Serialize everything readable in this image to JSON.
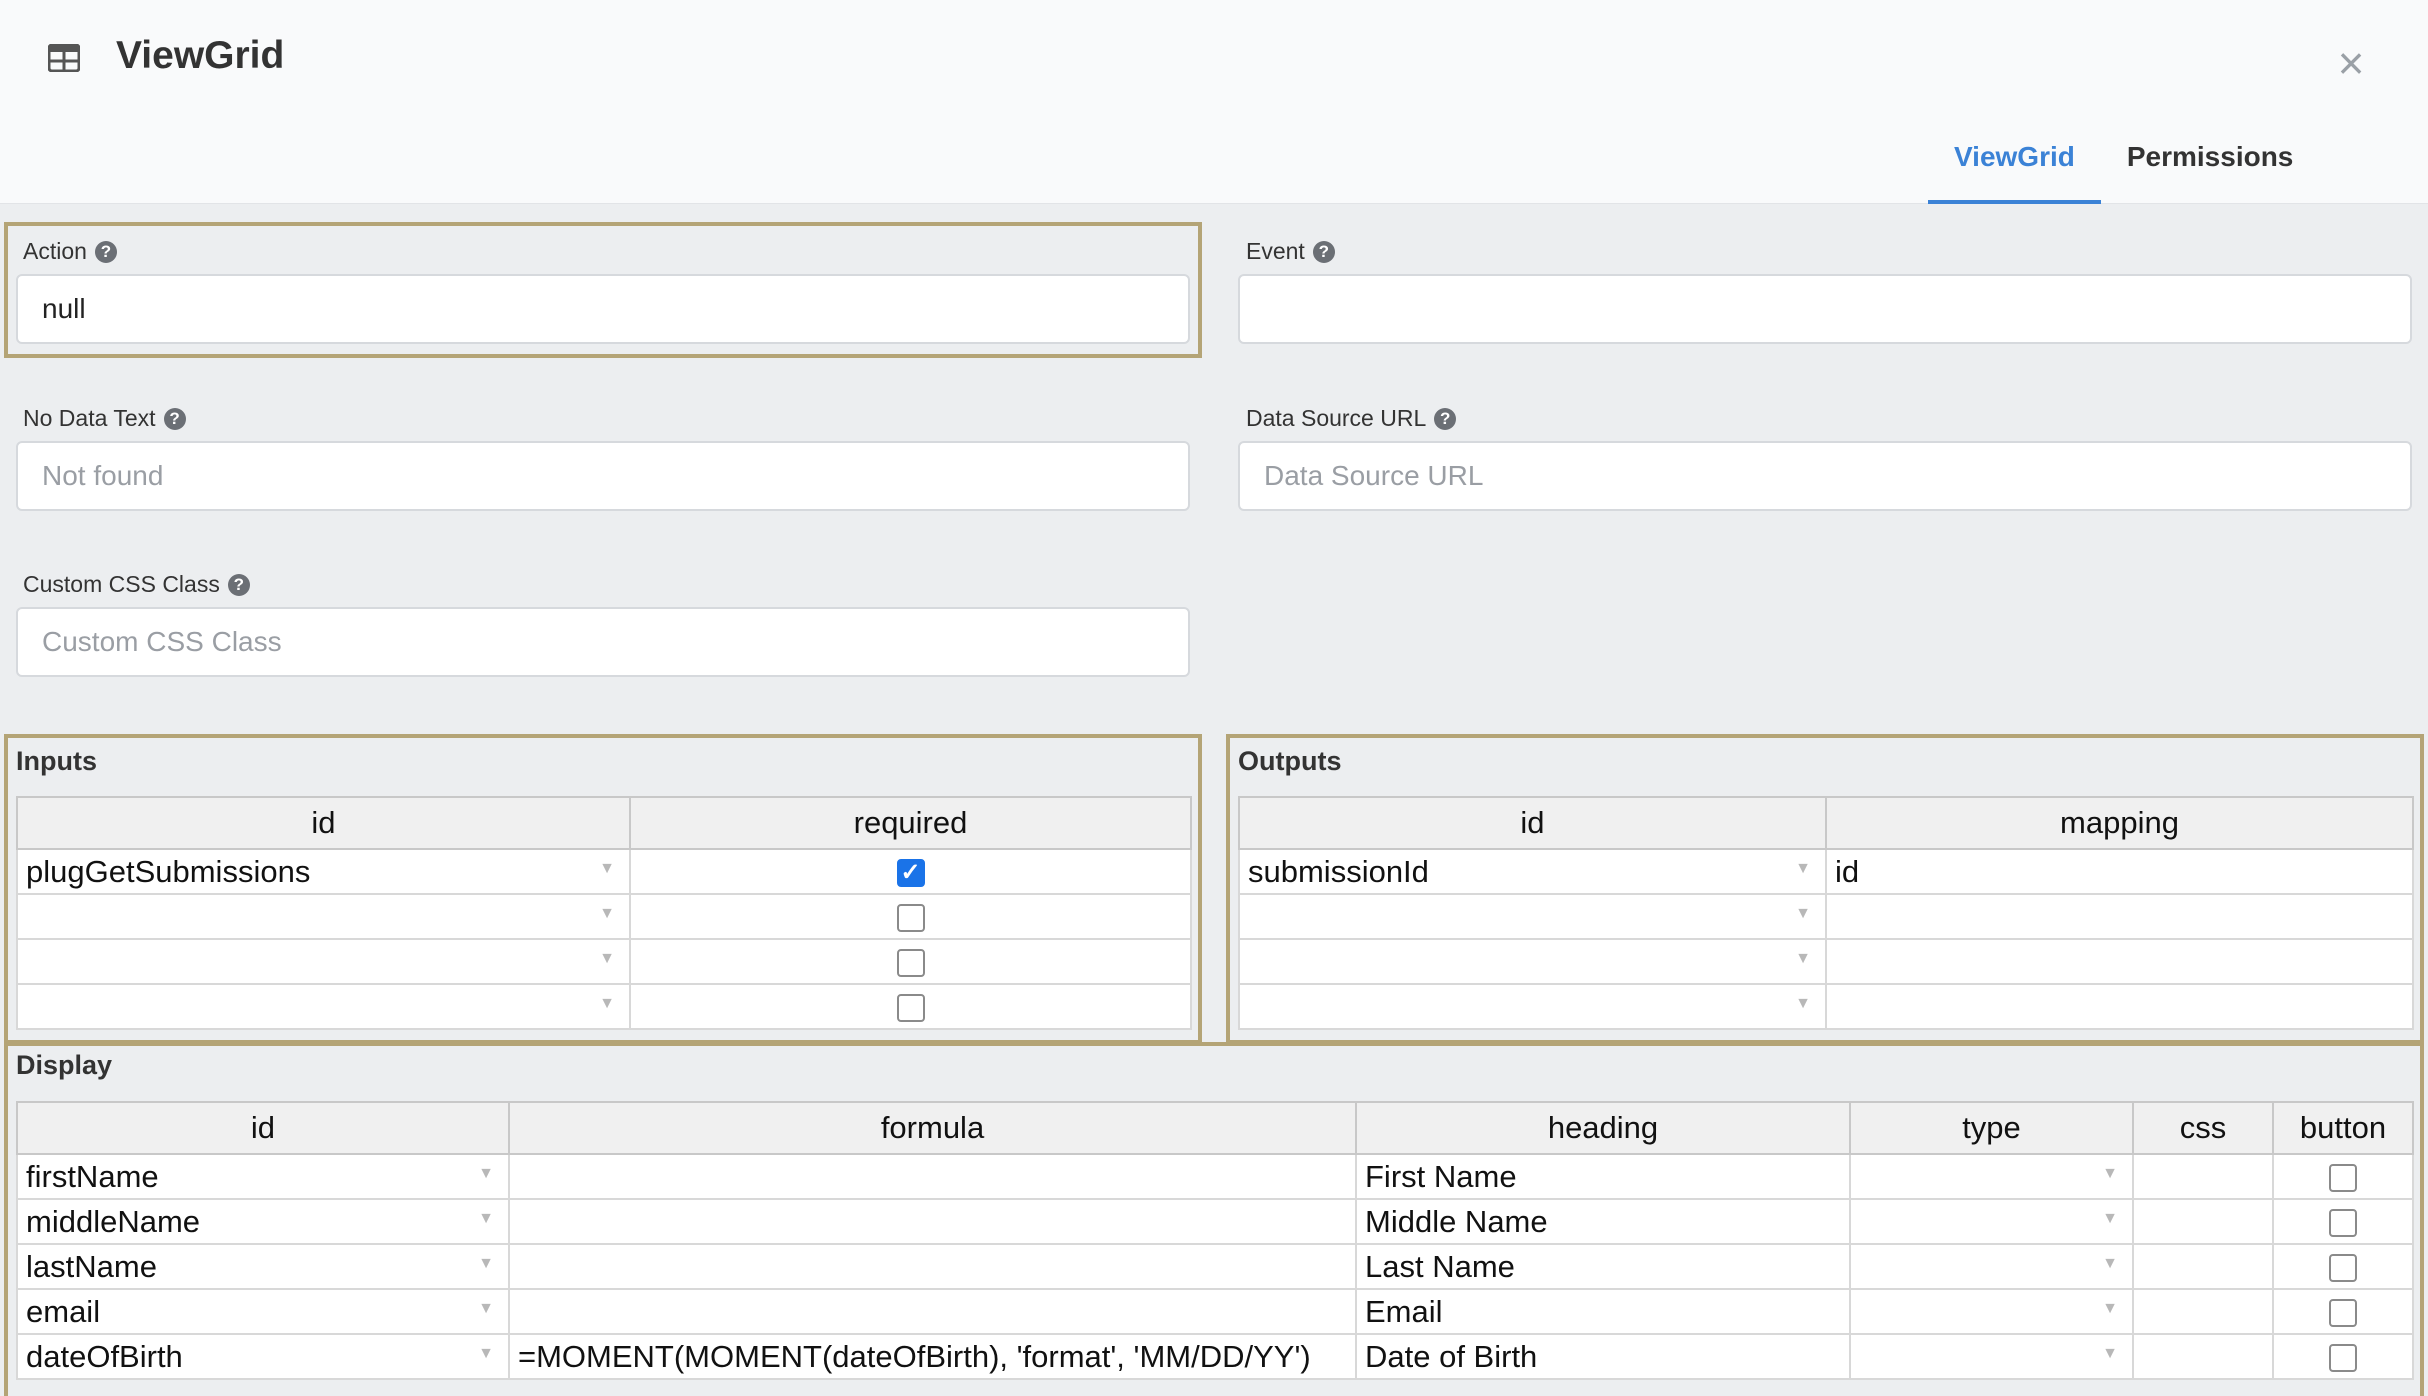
{
  "header": {
    "title": "ViewGrid",
    "close_label": "×",
    "tabs": [
      {
        "label": "ViewGrid",
        "active": true
      },
      {
        "label": "Permissions",
        "active": false
      }
    ]
  },
  "fields": {
    "action": {
      "label": "Action",
      "value": "null",
      "placeholder": ""
    },
    "event": {
      "label": "Event",
      "value": "",
      "placeholder": ""
    },
    "no_data_text": {
      "label": "No Data Text",
      "value": "",
      "placeholder": "Not found"
    },
    "data_source_url": {
      "label": "Data Source URL",
      "value": "",
      "placeholder": "Data Source URL"
    },
    "custom_css_class": {
      "label": "Custom CSS Class",
      "value": "",
      "placeholder": "Custom CSS Class"
    }
  },
  "inputs": {
    "title": "Inputs",
    "columns": [
      "id",
      "required"
    ],
    "rows": [
      {
        "id": "plugGetSubmissions",
        "required": true
      },
      {
        "id": "",
        "required": false
      },
      {
        "id": "",
        "required": false
      },
      {
        "id": "",
        "required": false
      }
    ]
  },
  "outputs": {
    "title": "Outputs",
    "columns": [
      "id",
      "mapping"
    ],
    "rows": [
      {
        "id": "submissionId",
        "mapping": "id"
      },
      {
        "id": "",
        "mapping": ""
      },
      {
        "id": "",
        "mapping": ""
      },
      {
        "id": "",
        "mapping": ""
      }
    ]
  },
  "display": {
    "title": "Display",
    "columns": [
      "id",
      "formula",
      "heading",
      "type",
      "css",
      "button"
    ],
    "rows": [
      {
        "id": "firstName",
        "formula": "",
        "heading": "First Name",
        "type": "",
        "css": "",
        "button": false
      },
      {
        "id": "middleName",
        "formula": "",
        "heading": "Middle Name",
        "type": "",
        "css": "",
        "button": false
      },
      {
        "id": "lastName",
        "formula": "",
        "heading": "Last Name",
        "type": "",
        "css": "",
        "button": false
      },
      {
        "id": "email",
        "formula": "",
        "heading": "Email",
        "type": "",
        "css": "",
        "button": false
      },
      {
        "id": "dateOfBirth",
        "formula": "=MOMENT(MOMENT(dateOfBirth), 'format', 'MM/DD/YY')",
        "heading": "Date of Birth",
        "type": "",
        "css": "",
        "button": false
      }
    ]
  },
  "icons": {
    "title": "table-grid-icon",
    "close": "close-icon",
    "help": "question-circle-icon",
    "dropdown": "dropdown-arrow-icon",
    "check": "checkmark-icon"
  },
  "colors": {
    "accent": "#3b82d6",
    "panel_border": "#b4a476",
    "checkbox_checked": "#1a73e8"
  }
}
